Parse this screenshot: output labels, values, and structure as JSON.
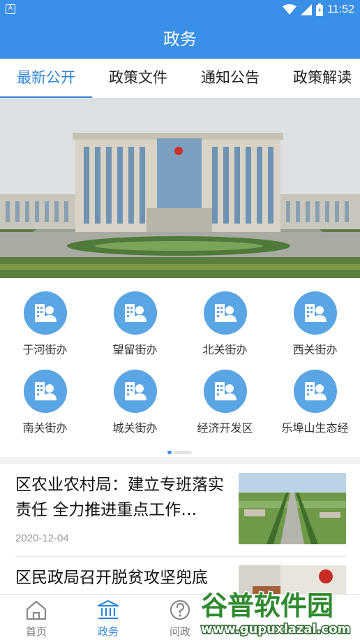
{
  "status_bar": {
    "app_badge": "A",
    "time": "11:52"
  },
  "header": {
    "title": "政务"
  },
  "tabs": [
    {
      "label": "最新公开",
      "active": true
    },
    {
      "label": "政策文件",
      "active": false
    },
    {
      "label": "通知公告",
      "active": false
    },
    {
      "label": "政策解读",
      "active": false
    }
  ],
  "districts": [
    {
      "label": "于河街办",
      "icon": "person-building-icon"
    },
    {
      "label": "望留街办",
      "icon": "person-building-icon"
    },
    {
      "label": "北关街办",
      "icon": "person-building-icon"
    },
    {
      "label": "西关街办",
      "icon": "person-building-icon"
    },
    {
      "label": "南关街办",
      "icon": "person-building-icon"
    },
    {
      "label": "城关街办",
      "icon": "person-building-icon"
    },
    {
      "label": "经济开发区",
      "icon": "person-building-icon"
    },
    {
      "label": "乐埠山生态经",
      "icon": "person-building-icon"
    }
  ],
  "news": [
    {
      "title": "区农业农村局：建立专班落实责任 全力推进重点工作…",
      "date": "2020-12-04"
    },
    {
      "title": "区民政局召开脱贫攻坚兜底",
      "date": ""
    }
  ],
  "bottom_nav": [
    {
      "label": "首页",
      "icon": "home-icon",
      "active": false
    },
    {
      "label": "政务",
      "icon": "government-building-icon",
      "active": true
    },
    {
      "label": "问政",
      "icon": "question-icon",
      "active": false
    }
  ],
  "watermark": {
    "main": "谷普软件园",
    "url": "www.gupuxlazal.com"
  },
  "colors": {
    "primary": "#3a90e6",
    "active_tab": "#2f86d6",
    "icon_circle": "#5aa5e4"
  }
}
